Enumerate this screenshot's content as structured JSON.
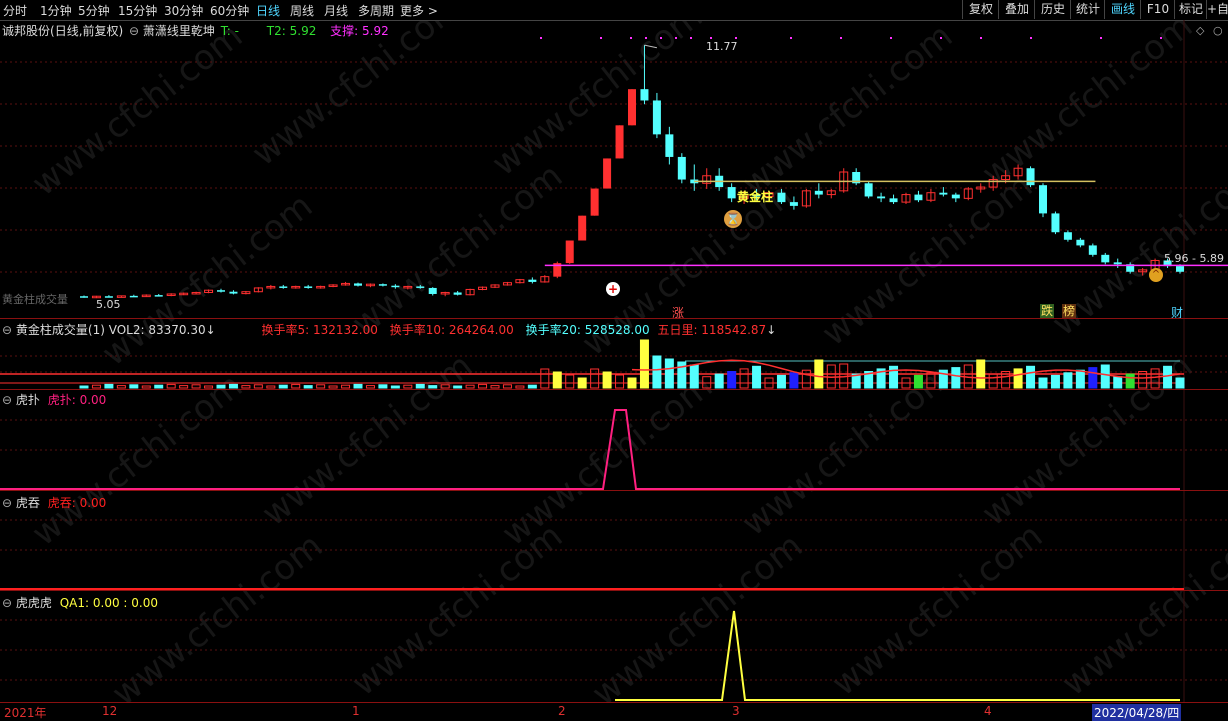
{
  "toolbar": {
    "periods": [
      "分时",
      "1分钟",
      "5分钟",
      "15分钟",
      "30分钟",
      "60分钟",
      "日线",
      "周线",
      "月线",
      "多周期",
      "更多 >"
    ],
    "active_period": "日线",
    "buttons": [
      "复权",
      "叠加",
      "历史",
      "统计",
      "画线",
      "F10",
      "标记",
      "+自"
    ],
    "active_button": "画线"
  },
  "main_panel": {
    "stock": "诚邦股份",
    "mode": "(日线,前复权)",
    "indicator": "萧潇线里乾坤",
    "t_label": "T: -",
    "t2_label": "T2: 5.92",
    "support_label": "支撑: 5.92",
    "high_label": "11.77",
    "low_label": "5.05",
    "range_label": "5.96 - 5.89",
    "gold_label": "黄金柱",
    "marker_zhang": "涨",
    "marker_die": "跌",
    "marker_bang": "榜",
    "marker_cai": "财",
    "ghost_label": "黄金柱成交量"
  },
  "volume_panel": {
    "title": "黄金柱成交量(1)",
    "vol2": "VOL2: 83370.30",
    "hs5": "换手率5: 132132.00",
    "hs10": "换手率10: 264264.00",
    "hs20": "换手率20: 528528.00",
    "wu": "五日里: 118542.87"
  },
  "hupu_panel": {
    "name": "虎扑",
    "value_label": "虎扑: 0.00"
  },
  "hutun_panel": {
    "name": "虎吞",
    "value_label": "虎吞: 0.00"
  },
  "huhu_panel": {
    "name": "虎虎虎",
    "value_label": "QA1: 0.00 : 0.00"
  },
  "date_axis": {
    "labels": [
      "2021年",
      "12",
      "1",
      "2",
      "3",
      "4"
    ],
    "selected": "2022/04/28/四"
  },
  "colors": {
    "up": "#ff3030",
    "down": "#54ffff",
    "magenta": "#ff30ff",
    "yellow": "#ffff40",
    "gold": "#d4c060"
  },
  "watermark": "www.cfchi.com",
  "chart_data": {
    "type": "candlestick",
    "price_range": [
      5.05,
      11.77
    ],
    "bars": [
      [
        5.1,
        5.12,
        5.06,
        5.08
      ],
      [
        5.08,
        5.11,
        5.05,
        5.1
      ],
      [
        5.1,
        5.13,
        5.07,
        5.09
      ],
      [
        5.09,
        5.12,
        5.06,
        5.11
      ],
      [
        5.11,
        5.14,
        5.08,
        5.1
      ],
      [
        5.1,
        5.15,
        5.08,
        5.13
      ],
      [
        5.13,
        5.16,
        5.1,
        5.12
      ],
      [
        5.12,
        5.18,
        5.1,
        5.16
      ],
      [
        5.16,
        5.2,
        5.13,
        5.18
      ],
      [
        5.18,
        5.22,
        5.15,
        5.2
      ],
      [
        5.2,
        5.28,
        5.18,
        5.26
      ],
      [
        5.26,
        5.3,
        5.2,
        5.22
      ],
      [
        5.22,
        5.26,
        5.15,
        5.17
      ],
      [
        5.17,
        5.24,
        5.15,
        5.22
      ],
      [
        5.22,
        5.34,
        5.2,
        5.32
      ],
      [
        5.32,
        5.4,
        5.28,
        5.36
      ],
      [
        5.36,
        5.4,
        5.3,
        5.34
      ],
      [
        5.34,
        5.38,
        5.3,
        5.36
      ],
      [
        5.36,
        5.4,
        5.3,
        5.32
      ],
      [
        5.32,
        5.38,
        5.3,
        5.36
      ],
      [
        5.36,
        5.42,
        5.34,
        5.4
      ],
      [
        5.4,
        5.48,
        5.38,
        5.44
      ],
      [
        5.44,
        5.46,
        5.36,
        5.38
      ],
      [
        5.38,
        5.44,
        5.34,
        5.42
      ],
      [
        5.42,
        5.44,
        5.36,
        5.38
      ],
      [
        5.38,
        5.42,
        5.3,
        5.34
      ],
      [
        5.34,
        5.38,
        5.28,
        5.36
      ],
      [
        5.36,
        5.4,
        5.3,
        5.32
      ],
      [
        5.32,
        5.34,
        5.12,
        5.16
      ],
      [
        5.16,
        5.22,
        5.1,
        5.2
      ],
      [
        5.2,
        5.24,
        5.12,
        5.14
      ],
      [
        5.14,
        5.3,
        5.12,
        5.28
      ],
      [
        5.28,
        5.36,
        5.26,
        5.34
      ],
      [
        5.34,
        5.42,
        5.32,
        5.4
      ],
      [
        5.4,
        5.48,
        5.38,
        5.46
      ],
      [
        5.46,
        5.56,
        5.44,
        5.54
      ],
      [
        5.54,
        5.6,
        5.44,
        5.48
      ],
      [
        5.48,
        5.66,
        5.46,
        5.62
      ],
      [
        5.62,
        6.02,
        5.58,
        5.98
      ],
      [
        5.98,
        6.58,
        5.96,
        6.58
      ],
      [
        6.58,
        7.24,
        6.58,
        7.24
      ],
      [
        7.24,
        7.96,
        7.24,
        7.96
      ],
      [
        7.96,
        8.76,
        7.96,
        8.76
      ],
      [
        8.76,
        9.64,
        8.76,
        9.64
      ],
      [
        9.64,
        10.6,
        9.64,
        10.6
      ],
      [
        10.6,
        11.77,
        10.2,
        10.3
      ],
      [
        10.3,
        10.5,
        9.3,
        9.4
      ],
      [
        9.4,
        9.6,
        8.6,
        8.8
      ],
      [
        8.8,
        8.9,
        8.1,
        8.2
      ],
      [
        8.2,
        8.6,
        7.9,
        8.1
      ],
      [
        8.1,
        8.5,
        7.95,
        8.3
      ],
      [
        8.3,
        8.5,
        7.9,
        8.0
      ],
      [
        8.0,
        8.1,
        7.6,
        7.7
      ],
      [
        7.7,
        7.9,
        7.55,
        7.8
      ],
      [
        7.8,
        7.95,
        7.65,
        7.75
      ],
      [
        7.75,
        7.9,
        7.6,
        7.85
      ],
      [
        7.85,
        7.95,
        7.55,
        7.6
      ],
      [
        7.6,
        7.75,
        7.4,
        7.5
      ],
      [
        7.5,
        7.95,
        7.45,
        7.9
      ],
      [
        7.9,
        8.1,
        7.7,
        7.8
      ],
      [
        7.8,
        7.95,
        7.7,
        7.9
      ],
      [
        7.9,
        8.5,
        7.85,
        8.4
      ],
      [
        8.4,
        8.5,
        8.05,
        8.1
      ],
      [
        8.1,
        8.15,
        7.7,
        7.75
      ],
      [
        7.75,
        7.85,
        7.6,
        7.7
      ],
      [
        7.7,
        7.8,
        7.55,
        7.6
      ],
      [
        7.6,
        7.85,
        7.55,
        7.8
      ],
      [
        7.8,
        7.9,
        7.6,
        7.65
      ],
      [
        7.65,
        7.95,
        7.6,
        7.85
      ],
      [
        7.85,
        8.0,
        7.75,
        7.8
      ],
      [
        7.8,
        7.85,
        7.6,
        7.7
      ],
      [
        7.7,
        8.0,
        7.65,
        7.95
      ],
      [
        7.95,
        8.1,
        7.85,
        8.0
      ],
      [
        8.0,
        8.3,
        7.9,
        8.2
      ],
      [
        8.2,
        8.45,
        8.1,
        8.3
      ],
      [
        8.3,
        8.6,
        8.2,
        8.5
      ],
      [
        8.5,
        8.55,
        8.0,
        8.05
      ],
      [
        8.05,
        8.1,
        7.2,
        7.3
      ],
      [
        7.3,
        7.35,
        6.75,
        6.8
      ],
      [
        6.8,
        6.85,
        6.55,
        6.6
      ],
      [
        6.6,
        6.65,
        6.4,
        6.45
      ],
      [
        6.45,
        6.5,
        6.15,
        6.2
      ],
      [
        6.2,
        6.25,
        5.95,
        6.0
      ],
      [
        6.0,
        6.1,
        5.85,
        5.95
      ],
      [
        5.95,
        6.0,
        5.7,
        5.75
      ],
      [
        5.75,
        5.85,
        5.65,
        5.8
      ],
      [
        5.8,
        6.1,
        5.75,
        6.05
      ],
      [
        6.05,
        6.1,
        5.85,
        5.9
      ],
      [
        5.9,
        5.95,
        5.7,
        5.75
      ]
    ]
  }
}
